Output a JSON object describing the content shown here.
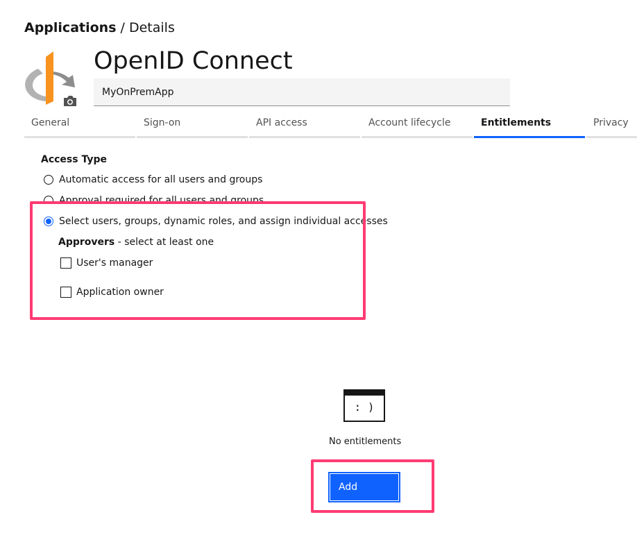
{
  "breadcrumb": {
    "root": "Applications",
    "separator": " / ",
    "current": "Details"
  },
  "app": {
    "title": "OpenID Connect",
    "name_value": "MyOnPremApp",
    "logo_icon": "openid-logo-icon",
    "camera_icon": "camera-icon"
  },
  "tabs": [
    {
      "label": "General",
      "active": false
    },
    {
      "label": "Sign-on",
      "active": false
    },
    {
      "label": "API access",
      "active": false
    },
    {
      "label": "Account lifecycle",
      "active": false
    },
    {
      "label": "Entitlements",
      "active": true
    },
    {
      "label": "Privacy",
      "active": false
    }
  ],
  "access": {
    "heading": "Access Type",
    "options": [
      {
        "label": "Automatic access for all users and groups",
        "checked": false
      },
      {
        "label": "Approval required for all users and groups",
        "checked": false
      },
      {
        "label": "Select users, groups, dynamic roles, and assign individual accesses",
        "checked": true
      }
    ],
    "approvers_label": "Approvers",
    "approvers_hint": " - select at least one",
    "approvers": [
      {
        "label": "User's manager",
        "checked": false
      },
      {
        "label": "Application owner",
        "checked": false
      }
    ]
  },
  "empty_state": {
    "icon_text": ": )",
    "message": "No entitlements"
  },
  "add_button": {
    "label": "Add"
  },
  "colors": {
    "accent": "#0f62fe",
    "highlight": "#ff3b73",
    "logo_orange": "#f7931e",
    "logo_gray": "#b2b2b2"
  }
}
